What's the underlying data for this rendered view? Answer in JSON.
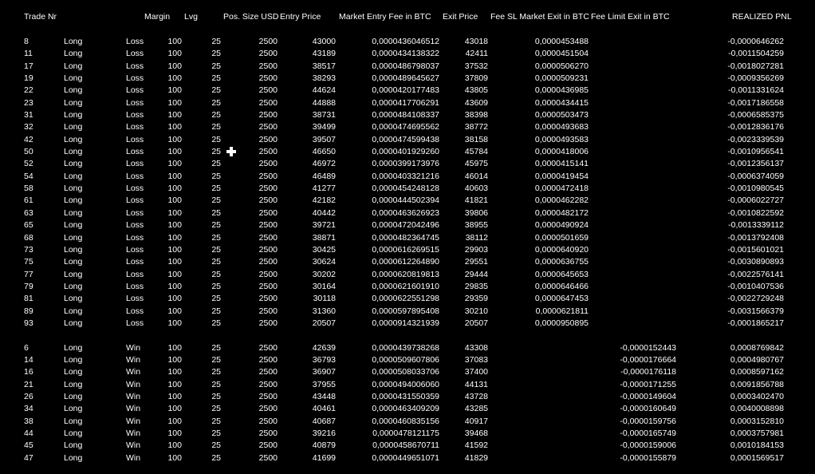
{
  "headers": {
    "trade_nr": "Trade Nr",
    "margin": "Margin",
    "lvg": "Lvg",
    "pos_size": "Pos. Size USD",
    "entry_price": "Entry Price",
    "market_entry_fee": "Market Entry Fee in BTC",
    "exit_price": "Exit Price",
    "fee_sl": "Fee SL Market Exit in BTC",
    "fee_limit": "Fee Limit Exit in BTC",
    "realized_pnl": "REALIZED PNL"
  },
  "loss_rows": [
    {
      "nr": "8",
      "dir": "Long",
      "res": "Loss",
      "margin": "100",
      "lvg": "25",
      "pos": "2500",
      "entry": "43000",
      "mef": "0,0000436046512",
      "exit": "43018",
      "sl": "0,0000453488",
      "lim": "",
      "pnl": "-0,0000646262"
    },
    {
      "nr": "11",
      "dir": "Long",
      "res": "Loss",
      "margin": "100",
      "lvg": "25",
      "pos": "2500",
      "entry": "43189",
      "mef": "0,0000434138322",
      "exit": "42411",
      "sl": "0,0000451504",
      "lim": "",
      "pnl": "-0,0011504259"
    },
    {
      "nr": "17",
      "dir": "Long",
      "res": "Loss",
      "margin": "100",
      "lvg": "25",
      "pos": "2500",
      "entry": "38517",
      "mef": "0,0000486798037",
      "exit": "37532",
      "sl": "0,0000506270",
      "lim": "",
      "pnl": "-0,0018027281"
    },
    {
      "nr": "19",
      "dir": "Long",
      "res": "Loss",
      "margin": "100",
      "lvg": "25",
      "pos": "2500",
      "entry": "38293",
      "mef": "0,0000489645627",
      "exit": "37809",
      "sl": "0,0000509231",
      "lim": "",
      "pnl": "-0,0009356269"
    },
    {
      "nr": "22",
      "dir": "Long",
      "res": "Loss",
      "margin": "100",
      "lvg": "25",
      "pos": "2500",
      "entry": "44624",
      "mef": "0,0000420177483",
      "exit": "43805",
      "sl": "0,0000436985",
      "lim": "",
      "pnl": "-0,0011331624"
    },
    {
      "nr": "23",
      "dir": "Long",
      "res": "Loss",
      "margin": "100",
      "lvg": "25",
      "pos": "2500",
      "entry": "44888",
      "mef": "0,0000417706291",
      "exit": "43609",
      "sl": "0,0000434415",
      "lim": "",
      "pnl": "-0,0017186558"
    },
    {
      "nr": "31",
      "dir": "Long",
      "res": "Loss",
      "margin": "100",
      "lvg": "25",
      "pos": "2500",
      "entry": "38731",
      "mef": "0,0000484108337",
      "exit": "38398",
      "sl": "0,0000503473",
      "lim": "",
      "pnl": "-0,0006585375"
    },
    {
      "nr": "32",
      "dir": "Long",
      "res": "Loss",
      "margin": "100",
      "lvg": "25",
      "pos": "2500",
      "entry": "39499",
      "mef": "0,0000474695562",
      "exit": "38772",
      "sl": "0,0000493683",
      "lim": "",
      "pnl": "-0,0012836176"
    },
    {
      "nr": "42",
      "dir": "Long",
      "res": "Loss",
      "margin": "100",
      "lvg": "25",
      "pos": "2500",
      "entry": "39507",
      "mef": "0,0000474599438",
      "exit": "38158",
      "sl": "0,0000493583",
      "lim": "",
      "pnl": "-0,0023339539"
    },
    {
      "nr": "50",
      "dir": "Long",
      "res": "Loss",
      "margin": "100",
      "lvg": "25",
      "pos": "2500",
      "entry": "46650",
      "mef": "0,0000401929260",
      "exit": "45784",
      "sl": "0,0000418006",
      "lim": "",
      "pnl": "-0,0010956541"
    },
    {
      "nr": "52",
      "dir": "Long",
      "res": "Loss",
      "margin": "100",
      "lvg": "25",
      "pos": "2500",
      "entry": "46972",
      "mef": "0,0000399173976",
      "exit": "45975",
      "sl": "0,0000415141",
      "lim": "",
      "pnl": "-0,0012356137"
    },
    {
      "nr": "54",
      "dir": "Long",
      "res": "Loss",
      "margin": "100",
      "lvg": "25",
      "pos": "2500",
      "entry": "46489",
      "mef": "0,0000403321216",
      "exit": "46014",
      "sl": "0,0000419454",
      "lim": "",
      "pnl": "-0,0006374059"
    },
    {
      "nr": "58",
      "dir": "Long",
      "res": "Loss",
      "margin": "100",
      "lvg": "25",
      "pos": "2500",
      "entry": "41277",
      "mef": "0,0000454248128",
      "exit": "40603",
      "sl": "0,0000472418",
      "lim": "",
      "pnl": "-0,0010980545"
    },
    {
      "nr": "61",
      "dir": "Long",
      "res": "Loss",
      "margin": "100",
      "lvg": "25",
      "pos": "2500",
      "entry": "42182",
      "mef": "0,0000444502394",
      "exit": "41821",
      "sl": "0,0000462282",
      "lim": "",
      "pnl": "-0,0006022727"
    },
    {
      "nr": "63",
      "dir": "Long",
      "res": "Loss",
      "margin": "100",
      "lvg": "25",
      "pos": "2500",
      "entry": "40442",
      "mef": "0,0000463626923",
      "exit": "39806",
      "sl": "0,0000482172",
      "lim": "",
      "pnl": "-0,0010822592"
    },
    {
      "nr": "65",
      "dir": "Long",
      "res": "Loss",
      "margin": "100",
      "lvg": "25",
      "pos": "2500",
      "entry": "39721",
      "mef": "0,0000472042496",
      "exit": "38955",
      "sl": "0,0000490924",
      "lim": "",
      "pnl": "-0,0013339112"
    },
    {
      "nr": "68",
      "dir": "Long",
      "res": "Loss",
      "margin": "100",
      "lvg": "25",
      "pos": "2500",
      "entry": "38871",
      "mef": "0,0000482364745",
      "exit": "38112",
      "sl": "0,0000501659",
      "lim": "",
      "pnl": "-0,0013792408"
    },
    {
      "nr": "73",
      "dir": "Long",
      "res": "Loss",
      "margin": "100",
      "lvg": "25",
      "pos": "2500",
      "entry": "30425",
      "mef": "0,0000616269515",
      "exit": "29903",
      "sl": "0,0000640920",
      "lim": "",
      "pnl": "-0,0015601021"
    },
    {
      "nr": "75",
      "dir": "Long",
      "res": "Loss",
      "margin": "100",
      "lvg": "25",
      "pos": "2500",
      "entry": "30624",
      "mef": "0,0000612264890",
      "exit": "29551",
      "sl": "0,0000636755",
      "lim": "",
      "pnl": "-0,0030890893"
    },
    {
      "nr": "77",
      "dir": "Long",
      "res": "Loss",
      "margin": "100",
      "lvg": "25",
      "pos": "2500",
      "entry": "30202",
      "mef": "0,0000620819813",
      "exit": "29444",
      "sl": "0,0000645653",
      "lim": "",
      "pnl": "-0,0022576141"
    },
    {
      "nr": "79",
      "dir": "Long",
      "res": "Loss",
      "margin": "100",
      "lvg": "25",
      "pos": "2500",
      "entry": "30164",
      "mef": "0,0000621601910",
      "exit": "29835",
      "sl": "0,0000646466",
      "lim": "",
      "pnl": "-0,0010407536"
    },
    {
      "nr": "81",
      "dir": "Long",
      "res": "Loss",
      "margin": "100",
      "lvg": "25",
      "pos": "2500",
      "entry": "30118",
      "mef": "0,0000622551298",
      "exit": "29359",
      "sl": "0,0000647453",
      "lim": "",
      "pnl": "-0,0022729248"
    },
    {
      "nr": "89",
      "dir": "Long",
      "res": "Loss",
      "margin": "100",
      "lvg": "25",
      "pos": "2500",
      "entry": "31360",
      "mef": "0,0000597895408",
      "exit": "30210",
      "sl": "0,0000621811",
      "lim": "",
      "pnl": "-0,0031566379"
    },
    {
      "nr": "93",
      "dir": "Long",
      "res": "Loss",
      "margin": "100",
      "lvg": "25",
      "pos": "2500",
      "entry": "20507",
      "mef": "0,0000914321939",
      "exit": "20507",
      "sl": "0,0000950895",
      "lim": "",
      "pnl": "-0,0001865217"
    }
  ],
  "win_rows": [
    {
      "nr": "6",
      "dir": "Long",
      "res": "Win",
      "margin": "100",
      "lvg": "25",
      "pos": "2500",
      "entry": "42639",
      "mef": "0,0000439738268",
      "exit": "43308",
      "sl": "",
      "lim": "-0,0000152443",
      "pnl": "0,0008769842"
    },
    {
      "nr": "14",
      "dir": "Long",
      "res": "Win",
      "margin": "100",
      "lvg": "25",
      "pos": "2500",
      "entry": "36793",
      "mef": "0,0000509607806",
      "exit": "37083",
      "sl": "",
      "lim": "-0,0000176664",
      "pnl": "0,0004980767"
    },
    {
      "nr": "16",
      "dir": "Long",
      "res": "Win",
      "margin": "100",
      "lvg": "25",
      "pos": "2500",
      "entry": "36907",
      "mef": "0,0000508033706",
      "exit": "37400",
      "sl": "",
      "lim": "-0,0000176118",
      "pnl": "0,0008597162"
    },
    {
      "nr": "21",
      "dir": "Long",
      "res": "Win",
      "margin": "100",
      "lvg": "25",
      "pos": "2500",
      "entry": "37955",
      "mef": "0,0000494006060",
      "exit": "44131",
      "sl": "",
      "lim": "-0,0000171255",
      "pnl": "0,0091856788"
    },
    {
      "nr": "26",
      "dir": "Long",
      "res": "Win",
      "margin": "100",
      "lvg": "25",
      "pos": "2500",
      "entry": "43448",
      "mef": "0,0000431550359",
      "exit": "43728",
      "sl": "",
      "lim": "-0,0000149604",
      "pnl": "0,0003402470"
    },
    {
      "nr": "34",
      "dir": "Long",
      "res": "Win",
      "margin": "100",
      "lvg": "25",
      "pos": "2500",
      "entry": "40461",
      "mef": "0,0000463409209",
      "exit": "43285",
      "sl": "",
      "lim": "-0,0000160649",
      "pnl": "0,0040008898"
    },
    {
      "nr": "38",
      "dir": "Long",
      "res": "Win",
      "margin": "100",
      "lvg": "25",
      "pos": "2500",
      "entry": "40687",
      "mef": "0,0000460835156",
      "exit": "40917",
      "sl": "",
      "lim": "-0,0000159756",
      "pnl": "0,0003152810"
    },
    {
      "nr": "44",
      "dir": "Long",
      "res": "Win",
      "margin": "100",
      "lvg": "25",
      "pos": "2500",
      "entry": "39216",
      "mef": "0,0000478121175",
      "exit": "39468",
      "sl": "",
      "lim": "-0,0000165749",
      "pnl": "0,0003757981"
    },
    {
      "nr": "45",
      "dir": "Long",
      "res": "Win",
      "margin": "100",
      "lvg": "25",
      "pos": "2500",
      "entry": "40879",
      "mef": "0,0000458670711",
      "exit": "41592",
      "sl": "",
      "lim": "-0,0000159006",
      "pnl": "0,0010184153"
    },
    {
      "nr": "47",
      "dir": "Long",
      "res": "Win",
      "margin": "100",
      "lvg": "25",
      "pos": "2500",
      "entry": "41699",
      "mef": "0,0000449651071",
      "exit": "41829",
      "sl": "",
      "lim": "-0,0000155879",
      "pnl": "0,0001569517"
    }
  ]
}
